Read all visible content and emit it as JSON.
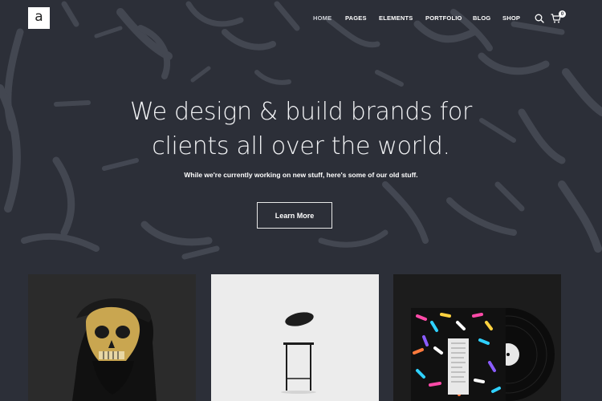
{
  "logo": {
    "letter": "a"
  },
  "nav": {
    "items": [
      {
        "label": "Home",
        "active": true
      },
      {
        "label": "Pages"
      },
      {
        "label": "Elements"
      },
      {
        "label": "Portfolio"
      },
      {
        "label": "Blog"
      },
      {
        "label": "Shop"
      }
    ],
    "icons": [
      "search-icon",
      "cart-icon"
    ],
    "cart_count": "0"
  },
  "hero": {
    "headline_line1": "We design & build brands for",
    "headline_line2": "clients all over the world.",
    "subtitle": "While we're currently working on new stuff, here's some of our old stuff.",
    "button_label": "Learn More"
  },
  "colors": {
    "background": "#2c2f38",
    "brush": "#4a4e59",
    "text": "#ffffff"
  }
}
